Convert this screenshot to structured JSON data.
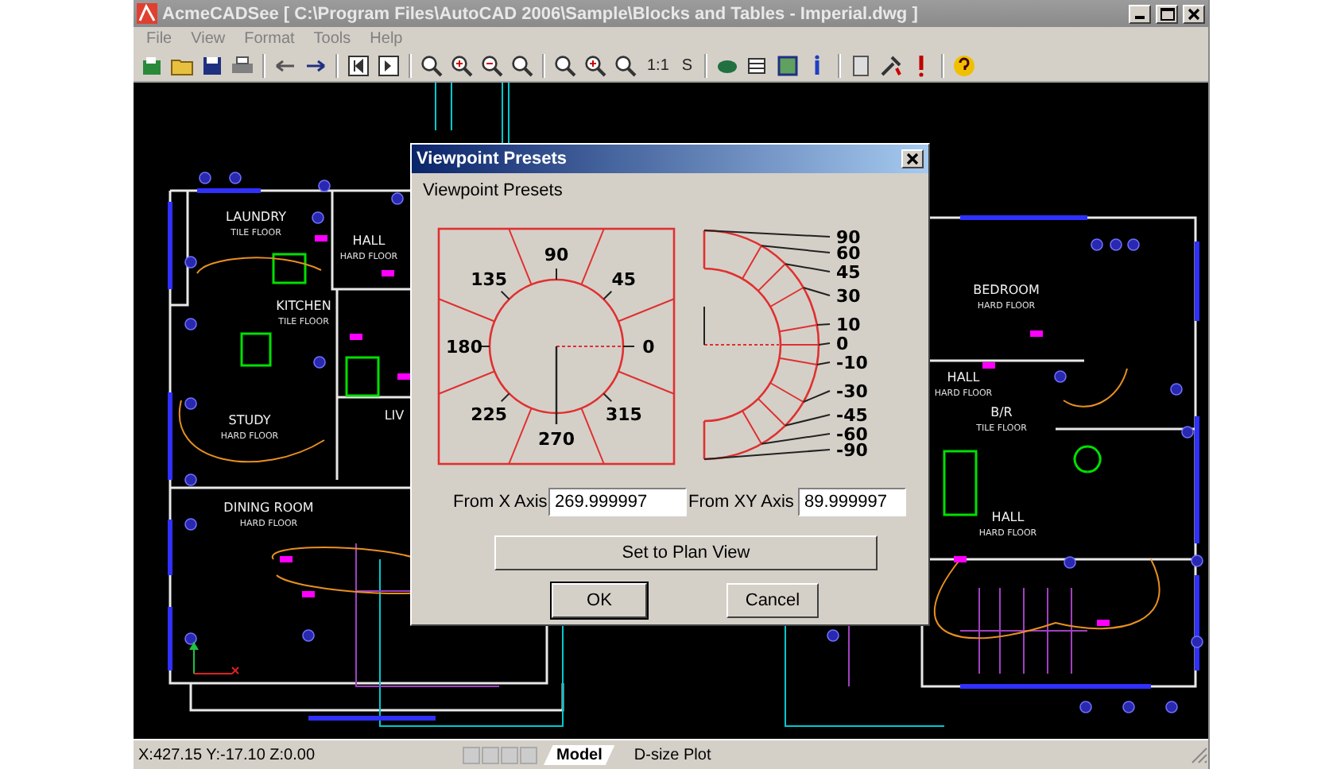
{
  "window": {
    "title": "AcmeCADSee [ C:\\Program Files\\AutoCAD 2006\\Sample\\Blocks and Tables - Imperial.dwg ]"
  },
  "menu": [
    "File",
    "View",
    "Format",
    "Tools",
    "Help"
  ],
  "toolbar": {
    "text_buttons": [
      "1:1",
      "S"
    ]
  },
  "drawing": {
    "rooms": [
      {
        "name": "LAUNDRY",
        "floor": "TILE FLOOR"
      },
      {
        "name": "HALL",
        "floor": "HARD FLOOR"
      },
      {
        "name": "KITCHEN",
        "floor": "TILE FLOOR"
      },
      {
        "name": "STUDY",
        "floor": "HARD FLOOR"
      },
      {
        "name": "DINING ROOM",
        "floor": "HARD FLOOR"
      },
      {
        "name": "LIV"
      },
      {
        "name": "BEDROOM",
        "floor": "HARD FLOOR"
      },
      {
        "name": "HALL",
        "floor": "HARD FLOOR"
      },
      {
        "name": "B/R",
        "floor": "TILE FLOOR"
      },
      {
        "name": "HALL",
        "floor": "HARD FLOOR"
      }
    ]
  },
  "dialog": {
    "title": "Viewpoint Presets",
    "heading": "Viewpoint Presets",
    "x_axis_labels": [
      "0",
      "45",
      "90",
      "135",
      "180",
      "225",
      "270",
      "315"
    ],
    "xy_axis_labels": [
      "90",
      "60",
      "45",
      "30",
      "10",
      "0",
      "-10",
      "-30",
      "-45",
      "-60",
      "-90"
    ],
    "from_x_label": "From X Axis",
    "from_x_value": "269.999997",
    "from_xy_label": "From XY Axis",
    "from_xy_value": "89.999997",
    "plan_button": "Set to Plan View",
    "ok": "OK",
    "cancel": "Cancel"
  },
  "status": {
    "coords": "X:427.15 Y:-17.10 Z:0.00",
    "tabs": [
      {
        "label": "Model",
        "selected": true
      },
      {
        "label": "D-size Plot",
        "selected": false
      }
    ]
  }
}
